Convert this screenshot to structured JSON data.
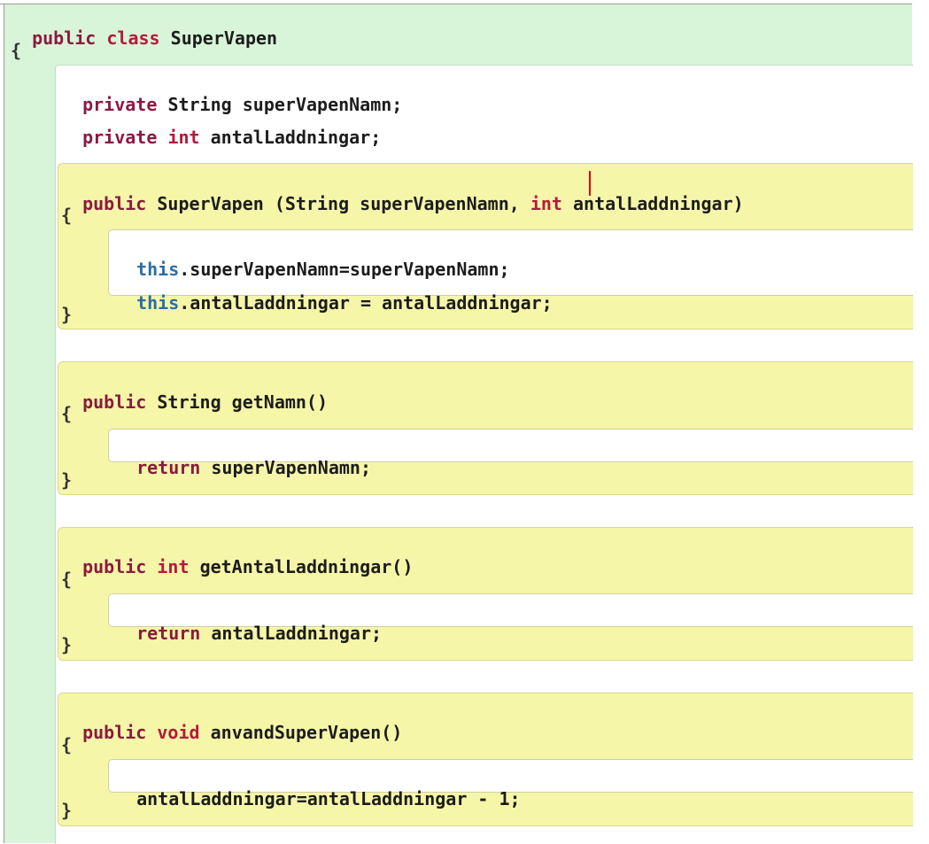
{
  "class_decl": {
    "kw_public": "public",
    "kw_class": "class",
    "name": "SuperVapen"
  },
  "open_brace": "{",
  "close_brace": "}",
  "fields": [
    {
      "modifier": "private",
      "type": "String",
      "rest": "superVapenNamn;"
    },
    {
      "modifier": "private",
      "type": "int",
      "rest": "antalLaddningar;"
    }
  ],
  "constructor": {
    "kw_public": "public",
    "sig_a": "SuperVapen (String superVapenNamn",
    "sig_b": ", ",
    "kw_int": "int",
    "sig_c": "antalLaddningar)",
    "body": [
      {
        "kw_this": "this",
        "text": ".superVapenNamn=superVapenNamn;"
      },
      {
        "kw_this": "this",
        "text": ".antalLaddningar = antalLaddningar;"
      }
    ]
  },
  "method_getNamn": {
    "kw_public": "public",
    "signature": "String getNamn()",
    "kw_return": "return",
    "body_text": "superVapenNamn;"
  },
  "method_getAntal": {
    "kw_public": "public",
    "kw_int": "int",
    "signature": "getAntalLaddningar()",
    "kw_return": "return",
    "body_text": "antalLaddningar;"
  },
  "method_anvand": {
    "kw_public": "public",
    "kw_void": "void",
    "signature": "anvandSuperVapen()",
    "body_text": "antalLaddningar=antalLaddningar - 1;"
  },
  "colors": {
    "class_scope_bg": "#d8f5d9",
    "method_scope_bg": "#f6f6a9",
    "keyword": "#8b1a3f",
    "type_keyword": "#b5193b",
    "this_keyword": "#2a6ea6",
    "caret": "#d9001a"
  }
}
